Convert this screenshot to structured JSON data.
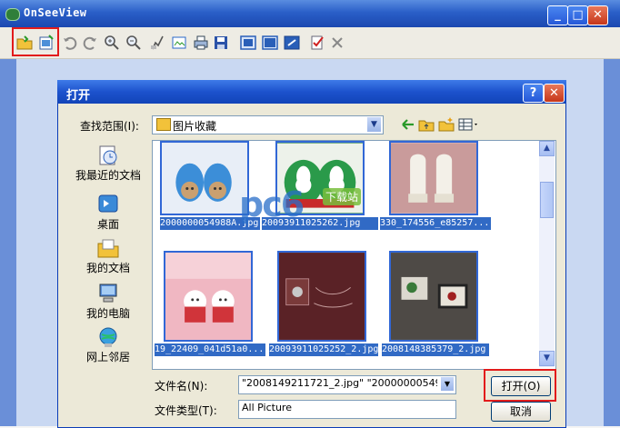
{
  "app": {
    "title": "OnSeeView",
    "min": "_",
    "max": "□",
    "close": "✕"
  },
  "toolbar": {
    "icons": [
      "open-folder-icon",
      "open-file-icon",
      "undo-icon",
      "redo-icon",
      "zoom-in-icon",
      "zoom-out-icon",
      "pan-icon",
      "slideshow-icon",
      "print-icon",
      "save-icon",
      "view-1-icon",
      "view-2-icon",
      "fullscreen-icon",
      "check-icon",
      "close-icon"
    ]
  },
  "dialog": {
    "title": "打开",
    "help": "?",
    "close": "✕",
    "lookin_label": "查找范围(I):",
    "lookin_value": "图片收藏",
    "places": [
      {
        "label": "我最近的文档",
        "icon": "recent-docs-icon"
      },
      {
        "label": "桌面",
        "icon": "desktop-icon"
      },
      {
        "label": "我的文档",
        "icon": "my-documents-icon"
      },
      {
        "label": "我的电脑",
        "icon": "my-computer-icon"
      },
      {
        "label": "网上邻居",
        "icon": "network-icon"
      }
    ],
    "files": [
      {
        "caption": "2000000054988A.jpg"
      },
      {
        "caption": "20093911025262.jpg"
      },
      {
        "caption": "330_174556_e85257..."
      },
      {
        "caption": "19_22409_041d51a0..."
      },
      {
        "caption": "20093911025252_2.jpg"
      },
      {
        "caption": "2008148385379_2.jpg"
      }
    ],
    "filename_label": "文件名(N):",
    "filename_value": "\"2008149211721_2.jpg\" \"2000000054988A.",
    "filetype_label": "文件类型(T):",
    "filetype_value": "All Picture",
    "open_button": "打开(O)",
    "cancel_button": "取消"
  },
  "watermark": {
    "text": "pc6",
    "sub": "下载站"
  }
}
